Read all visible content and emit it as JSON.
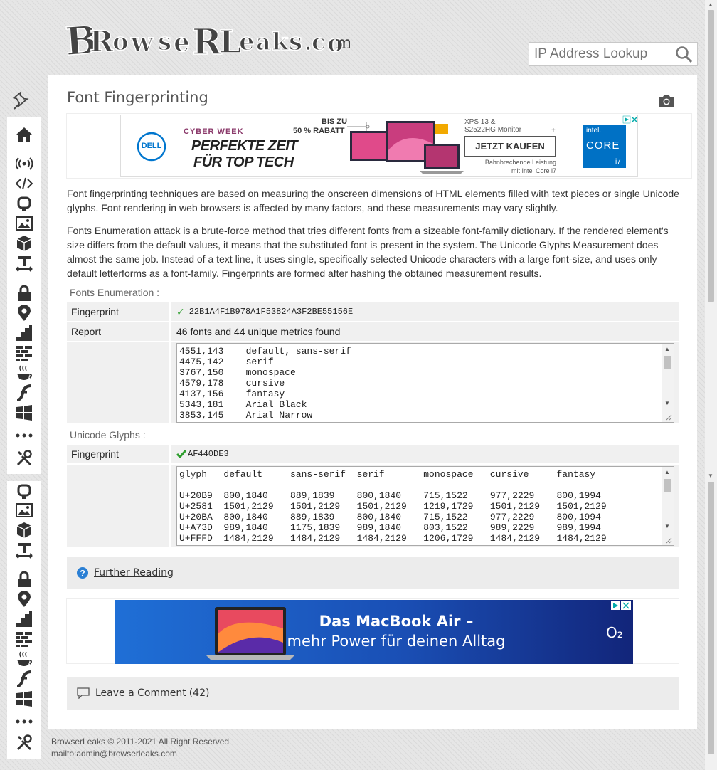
{
  "brand": {
    "logo_text": "BrowseRLeaks.com"
  },
  "search": {
    "placeholder": "IP Address Lookup"
  },
  "page": {
    "title": "Font Fingerprinting"
  },
  "ad_top": {
    "tag": "CYBER WEEK",
    "headline_1": "PERFEKTE ZEIT",
    "headline_2": "FÜR TOP TECH",
    "discount_1": "BIS ZU",
    "discount_2": "50 % RABATT",
    "product_1": "XPS 13 &",
    "product_2": "S2522HG Monitor",
    "plus": "+",
    "cta": "JETZT KAUFEN",
    "fine_1": "Bahnbrechende Leistung",
    "fine_2": "mit Intel Core i7",
    "dell": "DELL",
    "intel_1": "intel.",
    "intel_2": "CORE",
    "intel_3": "i7"
  },
  "intro": {
    "p1": "Font fingerprinting techniques are based on measuring the onscreen dimensions of HTML elements filled with text pieces or single Unicode glyphs. Font rendering in web browsers is affected by many factors, and these measurements may vary slightly.",
    "p2": "Fonts Enumeration attack is a brute-force method that tries different fonts from a sizeable font-family dictionary. If the rendered element's size differs from the default values, it means that the substituted font is present in the system. The Unicode Glyphs Measurement does almost the same job. Instead of a text line, it uses single, specifically selected Unicode characters with a large font-size, and uses only default letterforms as a font-family. Fingerprints are formed after hashing the obtained measurement results."
  },
  "fonts_enum": {
    "section_label": "Fonts Enumeration :",
    "fingerprint_label": "Fingerprint",
    "fingerprint_mark": "✓",
    "fingerprint_value": "22B1A4F1B978A1F53824A3F2BE55156E",
    "report_label": "Report",
    "report_value": "46 fonts and 44 unique metrics found",
    "list": "4551,143    default, sans-serif\n4475,142    serif\n3767,150    monospace\n4579,178    cursive\n4137,156    fantasy\n5343,181    Arial Black\n3853,145    Arial Narrow"
  },
  "unicode": {
    "section_label": "Unicode Glyphs :",
    "fingerprint_label": "Fingerprint",
    "fingerprint_value": "AF440DE3",
    "table": "glyph   default     sans-serif  serif       monospace   cursive     fantasy\n\nU+20B9  800,1840    889,1839    800,1840    715,1522    977,2229    800,1994\nU+2581  1501,2129   1501,2129   1501,2129   1219,1729   1501,2129   1501,2129\nU+20BA  800,1840    889,1839    800,1840    715,1522    977,2229    800,1994\nU+A73D  989,1840    1175,1839   989,1840    803,1522    989,2229    989,1994\nU+FFFD  1484,2129   1484,2129   1484,2129   1206,1729   1484,2129   1484,2129"
  },
  "further": {
    "label": "Further Reading"
  },
  "ad_bottom": {
    "line1": "Das MacBook Air –",
    "line2": "mehr Power für deinen Alltag",
    "brand": "O₂"
  },
  "comments": {
    "label": "Leave a Comment",
    "count": "(42)"
  },
  "footer": {
    "copyright": "BrowserLeaks © 2011-2021 All Right Reserved",
    "mail": "mailto:admin@browserleaks.com"
  },
  "sidebar_icons": {
    "top": [
      "home-icon",
      "wifi-signal-icon",
      "code-icon",
      "bug-icon",
      "image-icon",
      "cube-icon",
      "text-size-icon",
      "lock-icon",
      "location-pin-icon",
      "stairs-icon",
      "firewall-icon",
      "coffee-icon",
      "flash-icon",
      "windows-icon",
      "more-icon",
      "tools-icon"
    ],
    "bottom": [
      "bug-icon",
      "image-icon",
      "cube-icon",
      "text-size-icon",
      "lock-icon",
      "location-pin-icon",
      "stairs-icon",
      "firewall-icon",
      "coffee-icon",
      "flash-icon",
      "windows-icon",
      "more-icon",
      "tools-icon"
    ]
  },
  "colors": {
    "accent": "#2a7fd4",
    "check": "#2e9e2e",
    "panel": "#f0f0f0"
  }
}
